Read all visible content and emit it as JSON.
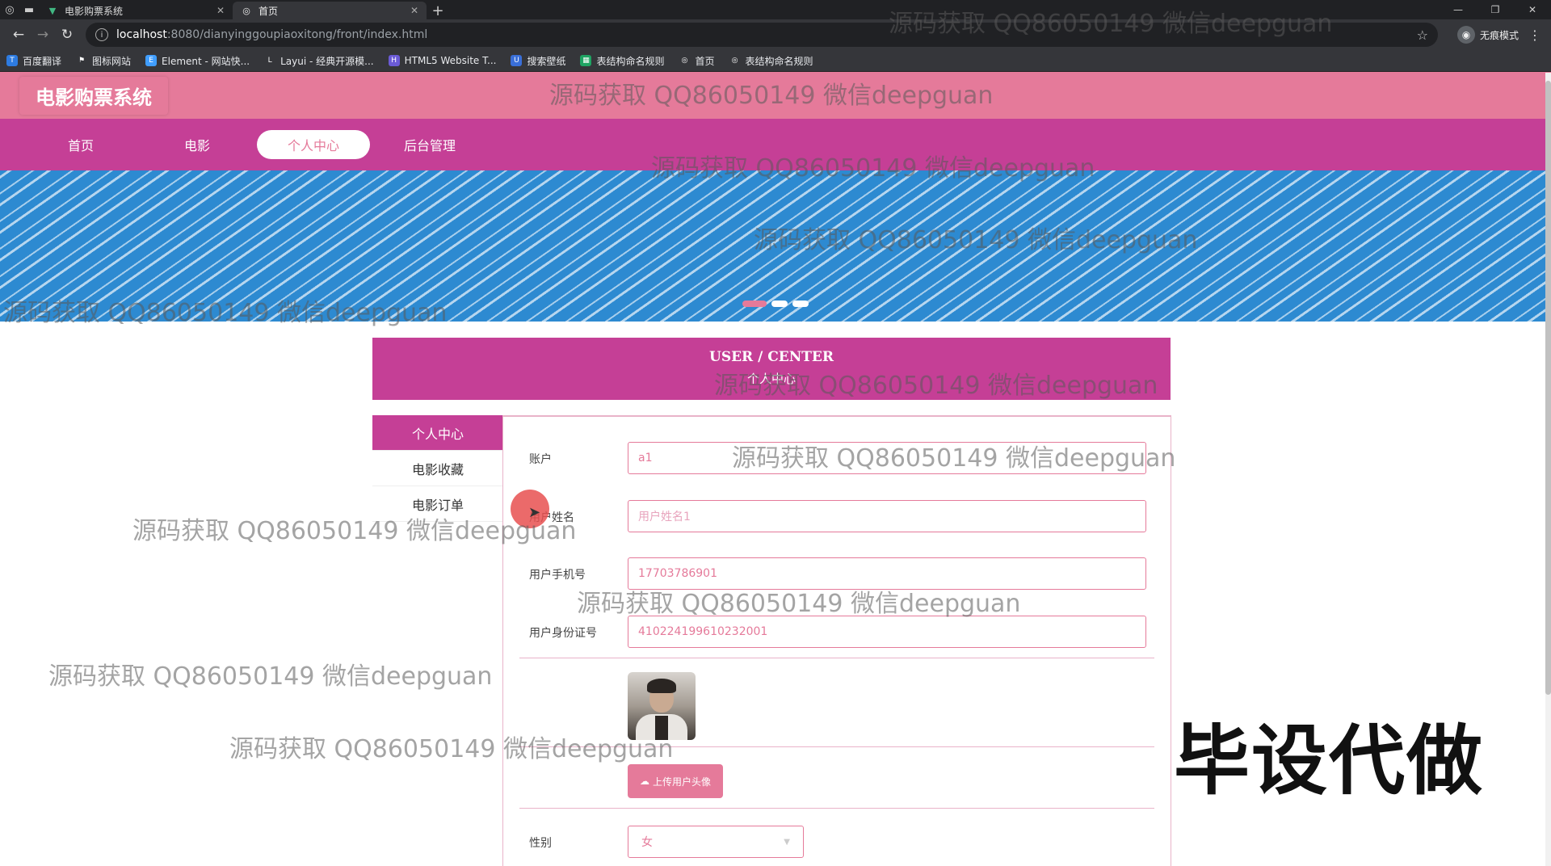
{
  "browser": {
    "tabs": [
      {
        "title": "电影购票系统",
        "active": false
      },
      {
        "title": "首页",
        "active": true
      }
    ],
    "url_host": "localhost",
    "url_path": ":8080/dianyinggoupiaoxitong/front/index.html",
    "profile_label": "无痕模式",
    "bookmarks": [
      "百度翻译",
      "图标网站",
      "Element - 网站快...",
      "Layui - 经典开源模...",
      "HTML5 Website T...",
      "搜索壁纸",
      "表结构命名规则",
      "首页",
      "表结构命名规则"
    ]
  },
  "site": {
    "title": "电影购票系统",
    "nav": [
      "首页",
      "电影",
      "个人中心",
      "后台管理"
    ],
    "nav_active": "个人中心"
  },
  "banner": {
    "slide_count": 3,
    "active_slide": 1
  },
  "user_center": {
    "heading_en": "USER / CENTER",
    "heading_cn": "个人中心",
    "side_menu": [
      "个人中心",
      "电影收藏",
      "电影订单"
    ],
    "form": {
      "account_label": "账户",
      "account_value": "a1",
      "name_label": "用户姓名",
      "name_placeholder": "用户姓名1",
      "phone_label": "用户手机号",
      "phone_value": "17703786901",
      "idcard_label": "用户身份证号",
      "idcard_value": "410224199610232001",
      "upload_label": "上传用户头像",
      "gender_label": "性别",
      "gender_value": "女"
    }
  },
  "overlay": {
    "watermark": "源码获取 QQ86050149 微信deepguan",
    "stamp": "毕设代做"
  },
  "colors": {
    "header_pink": "#e57a9a",
    "nav_magenta": "#c53f96",
    "banner_blue": "#2d8ad1"
  }
}
